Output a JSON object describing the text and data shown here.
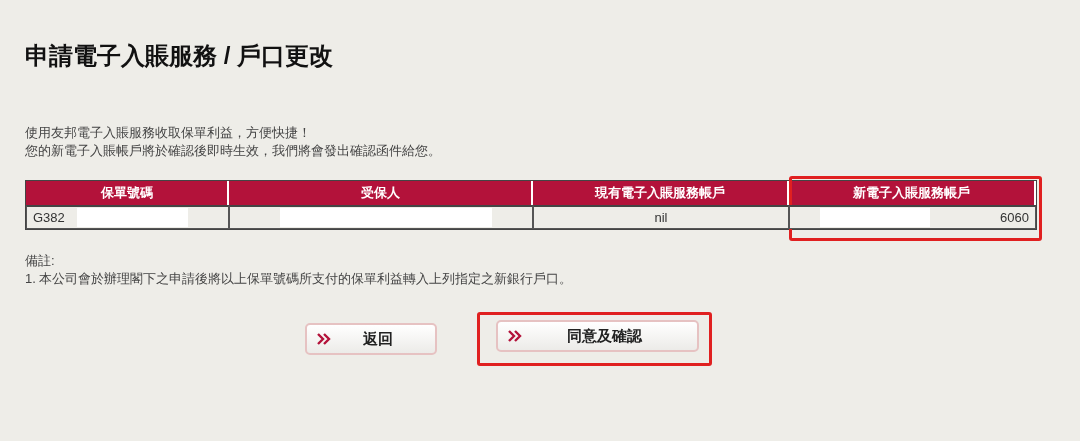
{
  "title": "申請電子入賬服務 / 戶口更改",
  "intro": [
    "使用友邦電子入賬服務收取保單利益，方便快捷！",
    "您的新電子入賬帳戶將於確認後即時生效，我們將會發出確認函件給您。"
  ],
  "table": {
    "columns": [
      {
        "label": "保單號碼",
        "highlighted": false
      },
      {
        "label": "受保人",
        "highlighted": false
      },
      {
        "label": "現有電子入賬服務帳戶",
        "highlighted": false
      },
      {
        "label": "新電子入賬服務帳戶",
        "highlighted": true
      }
    ],
    "rows": [
      [
        {
          "text": "G382",
          "redacted": true
        },
        {
          "text": "",
          "redacted": true
        },
        {
          "text": "nil",
          "redacted": false
        },
        {
          "text": "6060",
          "redacted": true
        }
      ]
    ]
  },
  "remarks": {
    "heading": "備註:",
    "items": [
      "1. 本公司會於辦理閣下之申請後將以上保單號碼所支付的保單利益轉入上列指定之新銀行戶口。"
    ]
  },
  "buttons": [
    {
      "label": "返回",
      "highlighted": false
    },
    {
      "label": "同意及確認",
      "highlighted": true
    }
  ]
}
